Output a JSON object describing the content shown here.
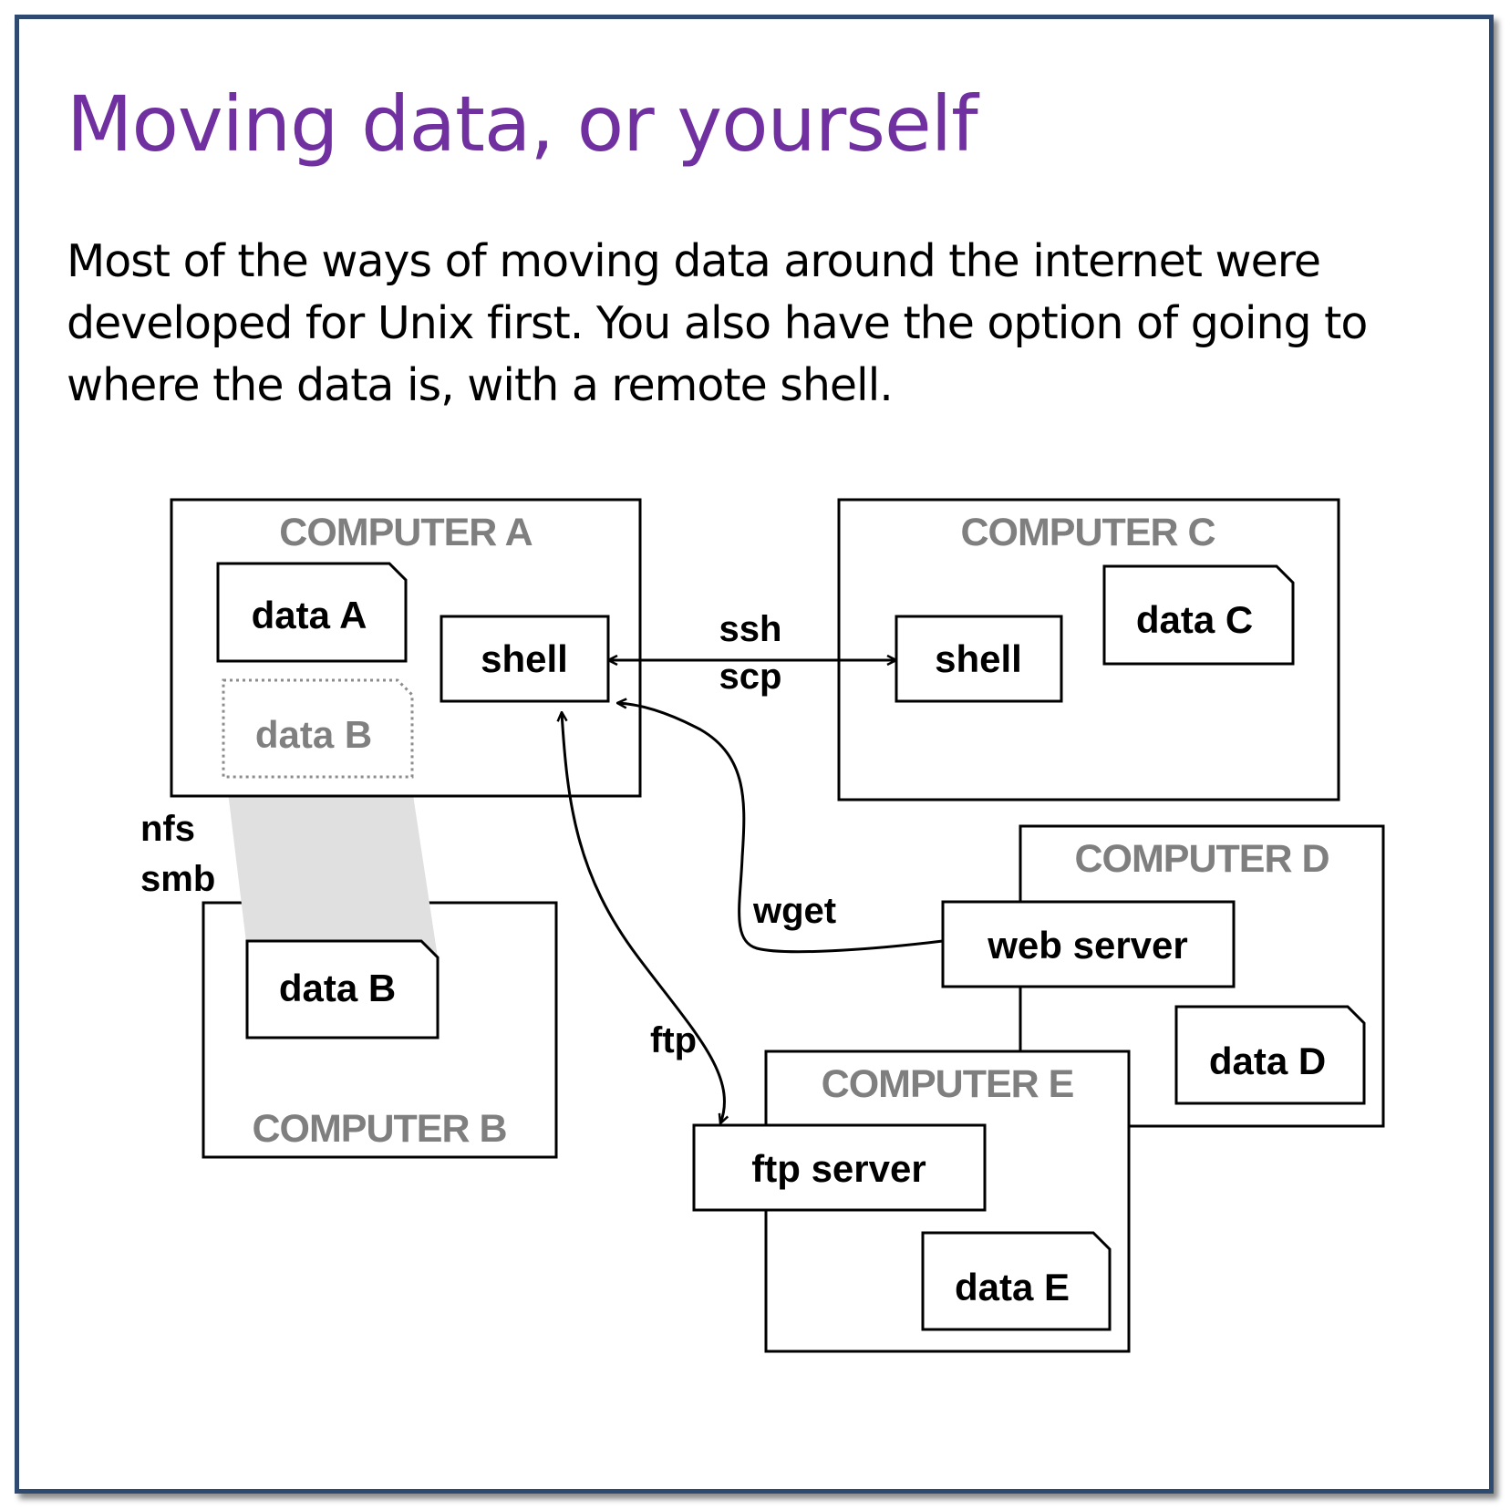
{
  "slide": {
    "title": "Moving data, or yourself",
    "body": "Most of the ways of moving data around the internet were developed for Unix first. You also have the option of going to where the data is, with a remote shell.",
    "title_color": "#7030a0",
    "border_color": "#2f4a70"
  },
  "diagram": {
    "computers": {
      "a": "COMPUTER A",
      "b": "COMPUTER B",
      "c": "COMPUTER C",
      "d": "COMPUTER D",
      "e": "COMPUTER E"
    },
    "data": {
      "a": "data A",
      "b_mounted": "data B",
      "b": "data B",
      "c": "data C",
      "d": "data D",
      "e": "data E"
    },
    "services": {
      "shell_a": "shell",
      "shell_c": "shell",
      "web_server": "web server",
      "ftp_server": "ftp server"
    },
    "protocols": {
      "ssh": "ssh",
      "scp": "scp",
      "nfs": "nfs",
      "smb": "smb",
      "wget": "wget",
      "ftp": "ftp"
    },
    "colors": {
      "computer_label": "#7f7f7f",
      "mounted_share": "#e0e0e0"
    }
  }
}
